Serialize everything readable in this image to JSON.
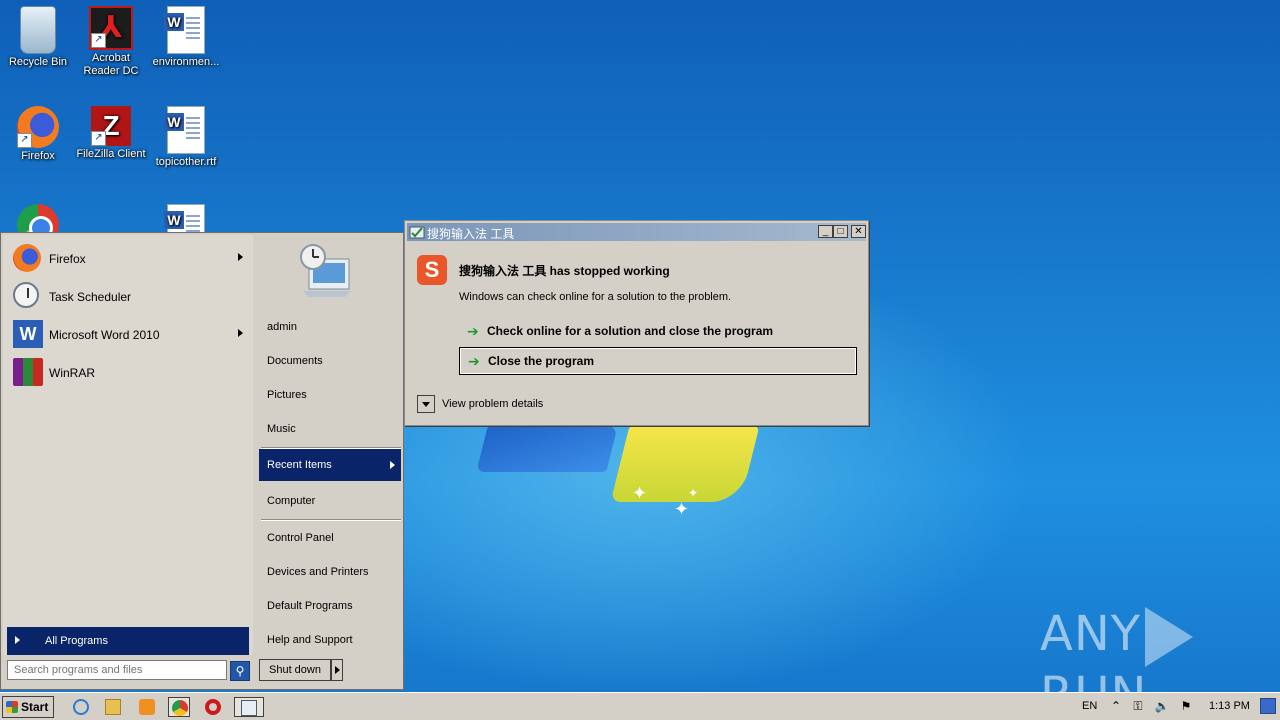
{
  "desktop": {
    "icons": [
      {
        "label": "Recycle Bin",
        "icon": "recycle-bin-icon"
      },
      {
        "label": "Acrobat Reader DC",
        "icon": "acrobat-icon"
      },
      {
        "label": "environmen...",
        "icon": "word-document-icon"
      },
      {
        "label": "Firefox",
        "icon": "firefox-icon"
      },
      {
        "label": "FileZilla Client",
        "icon": "filezilla-icon"
      },
      {
        "label": "topicother.rtf",
        "icon": "word-document-icon"
      }
    ]
  },
  "start_menu": {
    "programs": [
      {
        "label": "Firefox",
        "has_submenu": true
      },
      {
        "label": "Task Scheduler",
        "has_submenu": false
      },
      {
        "label": "Microsoft Word 2010",
        "has_submenu": true
      },
      {
        "label": "WinRAR",
        "has_submenu": false
      }
    ],
    "all_programs": "All Programs",
    "search_placeholder": "Search programs and files",
    "right_items": {
      "user": "admin",
      "documents": "Documents",
      "pictures": "Pictures",
      "music": "Music",
      "recent_items": "Recent Items",
      "computer": "Computer",
      "control_panel": "Control Panel",
      "devices_printers": "Devices and Printers",
      "default_programs": "Default Programs",
      "help_support": "Help and Support"
    },
    "shutdown_label": "Shut down"
  },
  "dialog": {
    "title": "搜狗输入法 工具",
    "heading": "搜狗输入法 工具 has stopped working",
    "message": "Windows can check online for a solution to the problem.",
    "option_check_online": "Check online for a solution and close the program",
    "option_close": "Close the program",
    "view_details": "View problem details",
    "title_buttons": [
      "_",
      "□",
      "✕"
    ]
  },
  "watermark": {
    "left": "ANY",
    "right": "RUN"
  },
  "taskbar": {
    "start_label": "Start",
    "language": "EN",
    "clock": "1:13 PM"
  },
  "colors": {
    "selection": "#0a246a",
    "dialog_bg": "#d4d0c8",
    "accent_green": "#1a9a2a"
  }
}
